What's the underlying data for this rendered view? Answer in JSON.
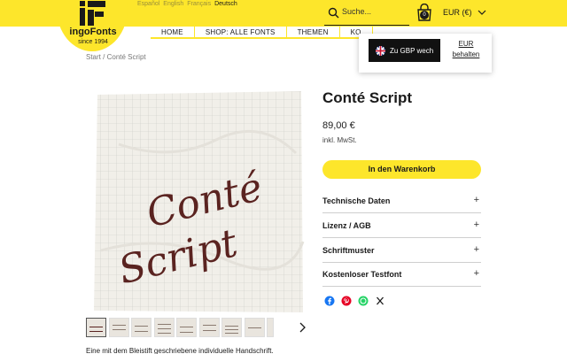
{
  "languages": [
    "Español",
    "English",
    "Français",
    "Deutsch"
  ],
  "brand": {
    "name": "ingoFonts",
    "since": "since 1994"
  },
  "search": {
    "placeholder": "Suche..."
  },
  "cart": {
    "count": "0"
  },
  "currency": {
    "selected": "EUR (€)"
  },
  "nav": [
    "HOME",
    "SHOP: ALLE FONTS",
    "THEMEN",
    "KO",
    "",
    ""
  ],
  "currency_popup": {
    "switch_label": "Zu GBP wech",
    "alt_line1": "EUR",
    "alt_line2": "behalten"
  },
  "breadcrumb": {
    "home": "Start",
    "separator": "/",
    "current": "Conté Script"
  },
  "product": {
    "title": "Conté Script",
    "price": "89,00 €",
    "tax_note": "inkl. MwSt.",
    "add_to_cart": "In den Warenkorb",
    "hero_word1": "Conté",
    "hero_word2": "Script"
  },
  "accordion": [
    "Technische Daten",
    "Lizenz / AGB",
    "Schriftmuster",
    "Kostenloser Testfont"
  ],
  "accordion_toggle": "+",
  "description": "Eine mit dem Bleistift geschriebene individuelle Handschrift.",
  "share": [
    "facebook-icon",
    "pinterest-icon",
    "whatsapp-icon",
    "x-icon"
  ],
  "colors": {
    "accent": "#fde62b",
    "ink": "#1a1a1a",
    "script": "#5a2320"
  }
}
